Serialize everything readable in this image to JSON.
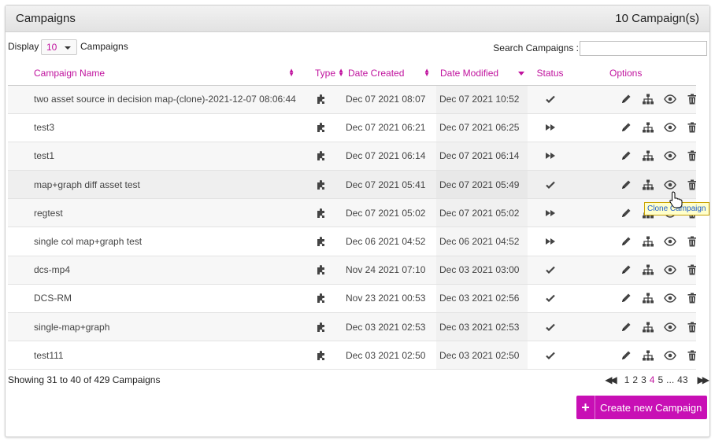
{
  "panel": {
    "title": "Campaigns",
    "count_label": "10 Campaign(s)"
  },
  "controls": {
    "display_label": "Display",
    "display_value": "10",
    "display_suffix": "Campaigns",
    "search_label": "Search Campaigns :",
    "search_value": ""
  },
  "table": {
    "headers": {
      "name": "Campaign Name",
      "type": "Type",
      "created": "Date Created",
      "modified": "Date Modified",
      "status": "Status",
      "options": "Options"
    },
    "rows": [
      {
        "name": "two asset source in decision map-(clone)-2021-12-07 08:06:44",
        "type_icon": "puzzle-icon",
        "created": "Dec 07 2021 08:07",
        "modified": "Dec 07 2021 10:52",
        "status": "check"
      },
      {
        "name": "test3",
        "type_icon": "puzzle-icon",
        "created": "Dec 07 2021 06:21",
        "modified": "Dec 07 2021 06:25",
        "status": "forward"
      },
      {
        "name": "test1",
        "type_icon": "puzzle-icon",
        "created": "Dec 07 2021 06:14",
        "modified": "Dec 07 2021 06:14",
        "status": "forward"
      },
      {
        "name": "map+graph diff asset test",
        "type_icon": "puzzle-icon",
        "created": "Dec 07 2021 05:41",
        "modified": "Dec 07 2021 05:49",
        "status": "check"
      },
      {
        "name": "regtest",
        "type_icon": "puzzle-icon",
        "created": "Dec 07 2021 05:02",
        "modified": "Dec 07 2021 05:02",
        "status": "forward"
      },
      {
        "name": "single col map+graph test",
        "type_icon": "puzzle-icon",
        "created": "Dec 06 2021 04:52",
        "modified": "Dec 06 2021 04:52",
        "status": "forward"
      },
      {
        "name": "dcs-mp4",
        "type_icon": "puzzle-icon",
        "created": "Nov 24 2021 07:10",
        "modified": "Dec 03 2021 03:00",
        "status": "check"
      },
      {
        "name": "DCS-RM",
        "type_icon": "puzzle-icon",
        "created": "Nov 23 2021 00:53",
        "modified": "Dec 03 2021 02:56",
        "status": "check"
      },
      {
        "name": "single-map+graph",
        "type_icon": "puzzle-icon",
        "created": "Dec 03 2021 02:53",
        "modified": "Dec 03 2021 02:53",
        "status": "check"
      },
      {
        "name": "test111",
        "type_icon": "puzzle-icon",
        "created": "Dec 03 2021 02:50",
        "modified": "Dec 03 2021 02:50",
        "status": "check"
      }
    ],
    "option_icons": [
      "pencil-icon",
      "sitemap-icon",
      "eye-icon",
      "trash-icon",
      "copy-icon"
    ]
  },
  "footer": {
    "info": "Showing 31 to 40 of 429 Campaigns",
    "pages": [
      "1",
      "2",
      "3",
      "4",
      "5"
    ],
    "active_page": "4",
    "ellipsis": "...",
    "last_page": "43"
  },
  "create_button": {
    "plus": "+",
    "label": "Create new Campaign"
  },
  "tooltip": {
    "text": "Clone Campaign"
  },
  "colors": {
    "accent": "#c0139e",
    "button": "#c80fb5",
    "tooltip_bg": "#ffffcc"
  }
}
